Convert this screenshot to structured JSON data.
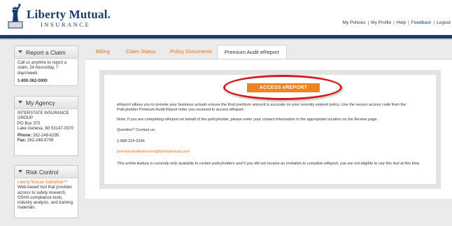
{
  "header": {
    "brand": "Liberty Mutual.",
    "brand_sub": "INSURANCE",
    "nav": [
      "My Policies",
      "My Profile",
      "Help",
      "Feedback",
      "Logout"
    ]
  },
  "sidebar": {
    "claim": {
      "title": "Report a Claim",
      "text": "Call us anytime to report a claim, 24 hours/day, 7 days/week",
      "phone": "1-800-362-0000"
    },
    "agency": {
      "title": "My Agency",
      "name": "INTERSTATE INSURANCE GROUP",
      "address1": "PO Box 370",
      "address2": "Lake Geneva, WI 53147-0370",
      "phone_label": "Phone:",
      "phone": "262-248-6295",
      "fax_label": "Fax:",
      "fax": "262-248-9708"
    },
    "risk": {
      "title": "Risk Control",
      "link": "Liberty Mutual SafetyNet™",
      "text": "Web-based tool that provides access to safety research, OSHA compliance tools, industry analysis, and training materials."
    }
  },
  "tabs": [
    "Billing",
    "Claim Status",
    "Policy Documents",
    "Premium Audit eReport"
  ],
  "main": {
    "button": "ACCESS eREPORT",
    "p1": "eReport allows you to provide your business actuals ensure the final premium amount is accurate on your recently expired policy. Use the secure access code from the Policyholder Premium Audit Report letter you received to access eReport.",
    "p2": "Note: If you are completing eReport on behalf of the policyholder, please enter your contact information in the appropriate location on the Review page.",
    "p3": "Question? Contact us:",
    "phone": "1-888-224-9246",
    "email": "premiumauditservices@libertymutual.com",
    "p4": "This online feature is currently only available to certain policyholders and if you did not receive an invitation to complete eReport, you are not eligible to use this tool at this time."
  },
  "colors": {
    "brand_blue": "#1a3b6e",
    "accent_orange": "#ee8421",
    "highlight_red": "#d41b1b"
  }
}
